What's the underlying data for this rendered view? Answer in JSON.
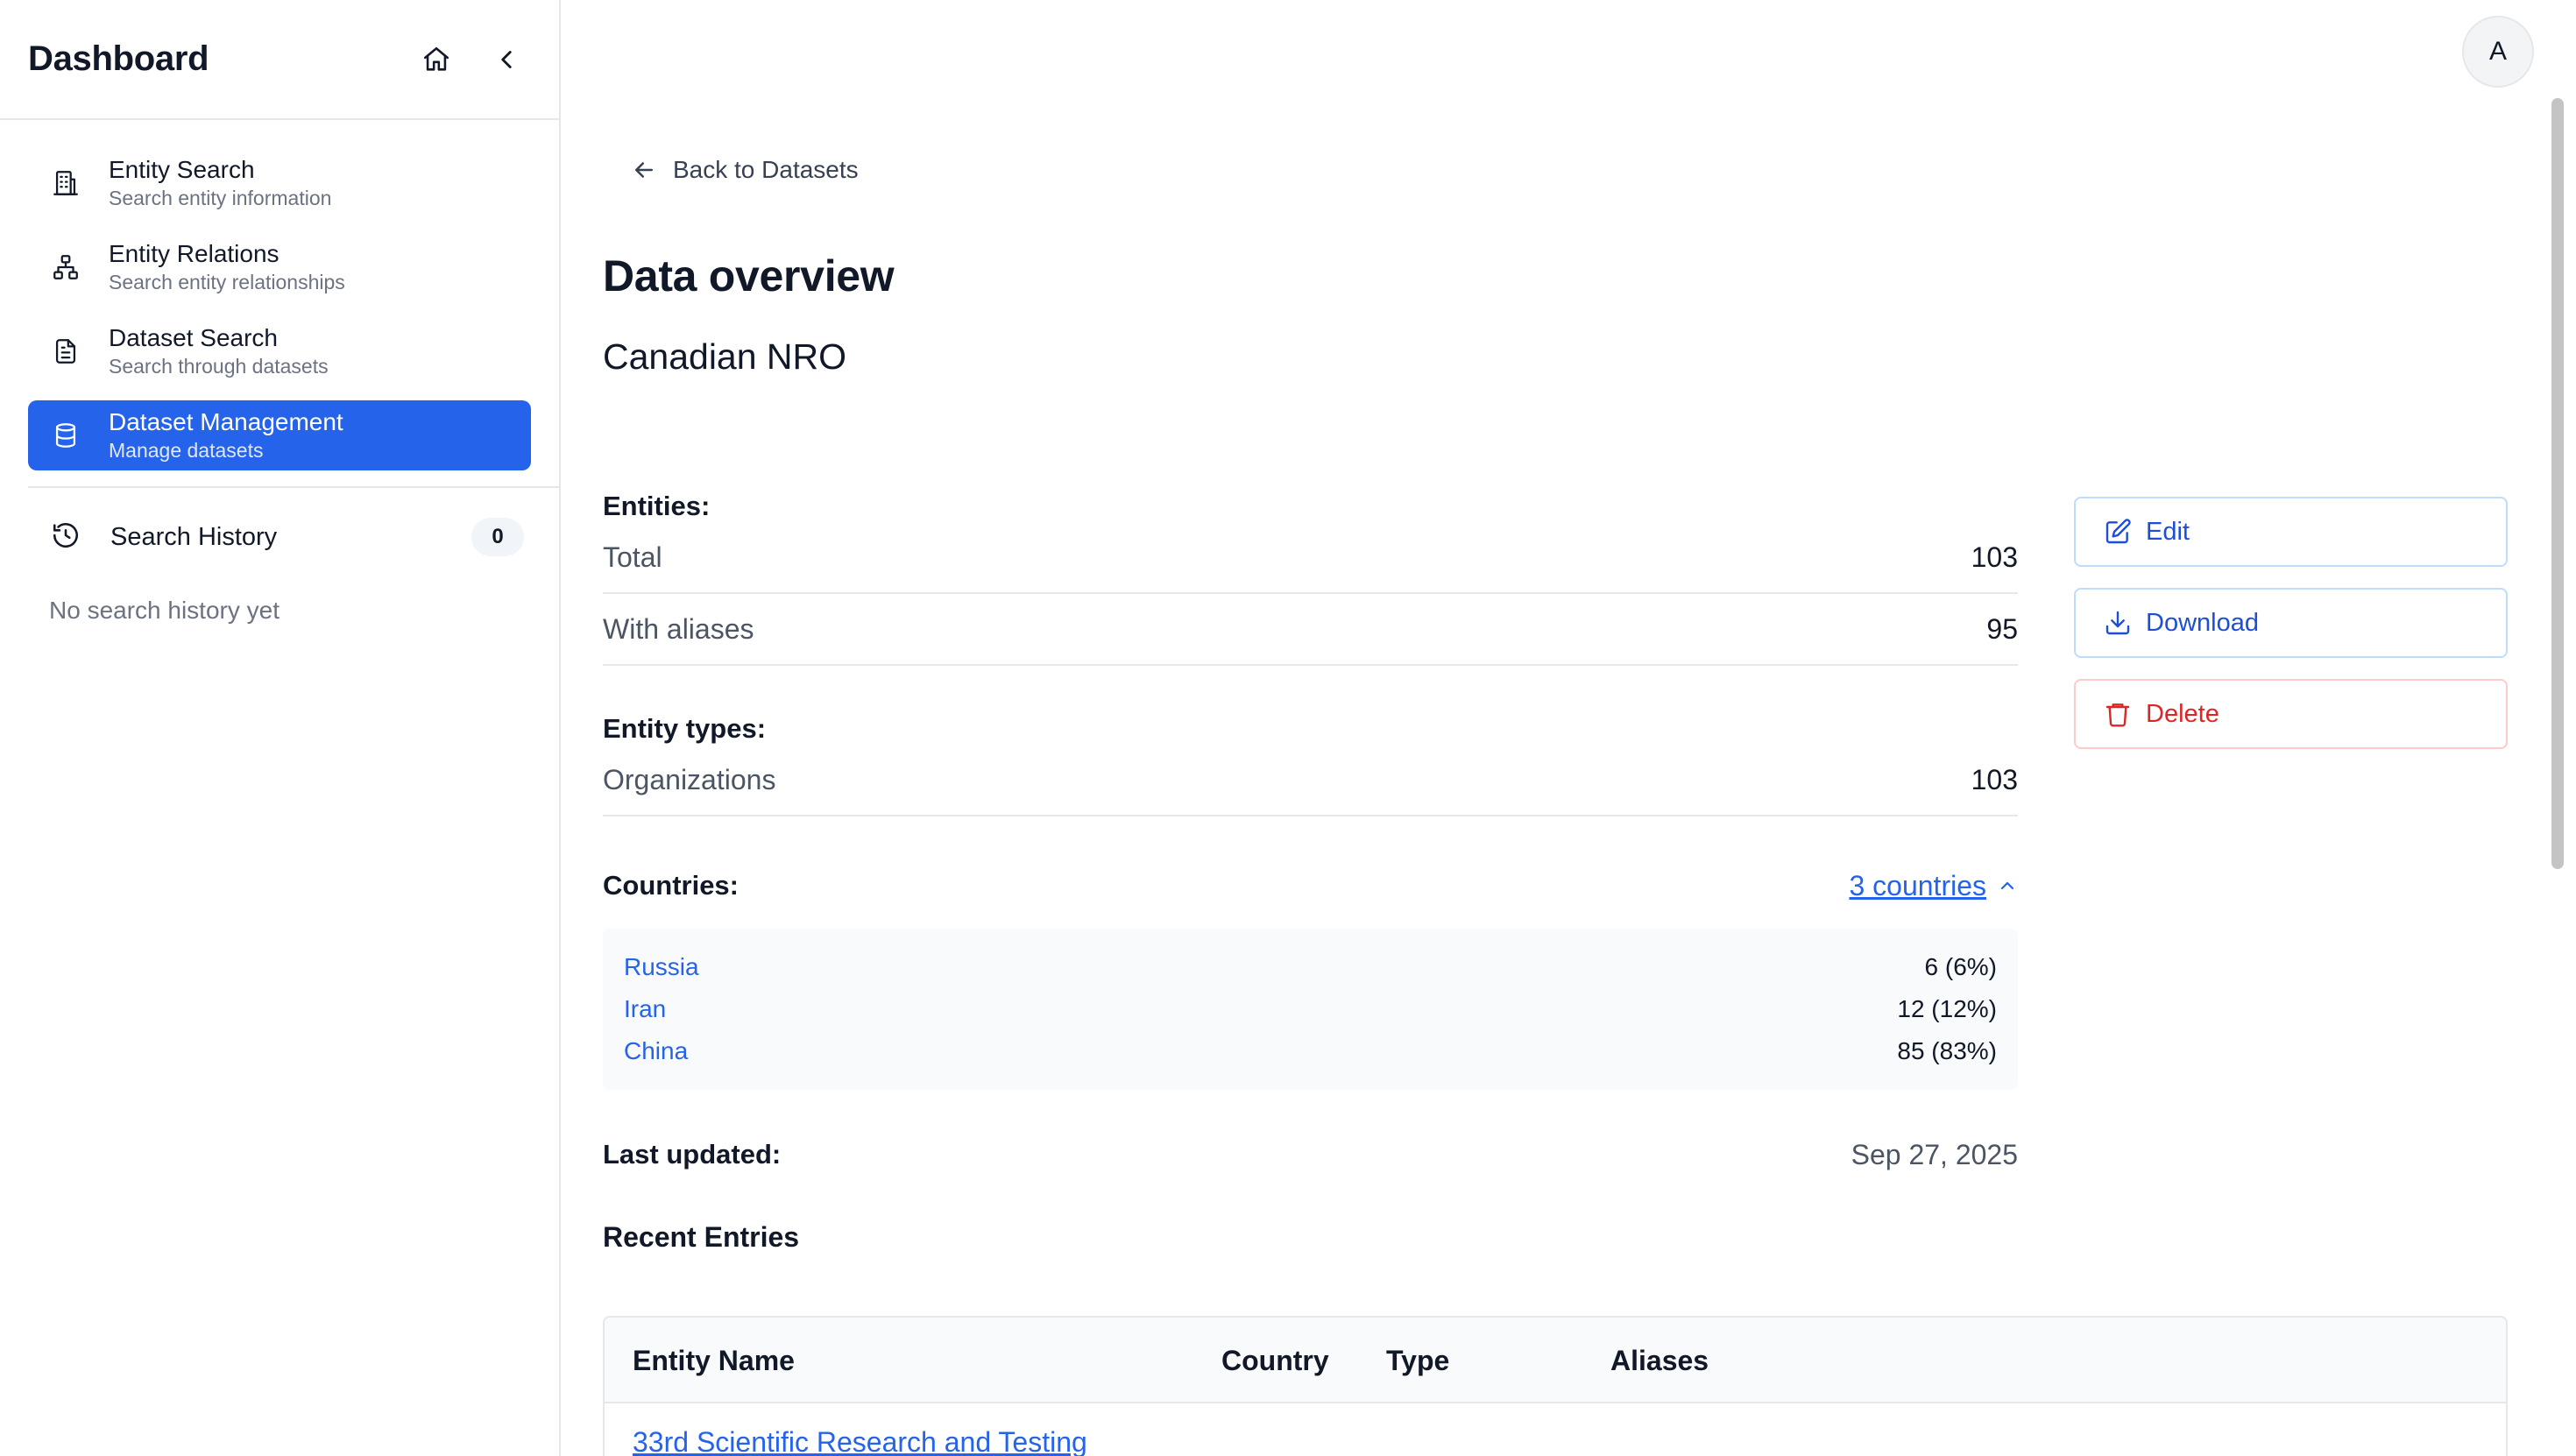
{
  "sidebar": {
    "title": "Dashboard",
    "nav": [
      {
        "label": "Entity Search",
        "sub": "Search entity information",
        "icon": "building-icon"
      },
      {
        "label": "Entity Relations",
        "sub": "Search entity relationships",
        "icon": "network-icon"
      },
      {
        "label": "Dataset Search",
        "sub": "Search through datasets",
        "icon": "document-icon"
      },
      {
        "label": "Dataset Management",
        "sub": "Manage datasets",
        "icon": "database-icon",
        "active": true
      }
    ],
    "history": {
      "label": "Search History",
      "count": "0",
      "empty": "No search history yet"
    }
  },
  "user": {
    "avatar_initial": "A"
  },
  "main": {
    "back_label": "Back to Datasets",
    "title": "Data overview",
    "dataset_name": "Canadian NRO",
    "entities": {
      "title": "Entities:",
      "rows": [
        {
          "label": "Total",
          "value": "103"
        },
        {
          "label": "With aliases",
          "value": "95"
        }
      ]
    },
    "entity_types": {
      "title": "Entity types:",
      "rows": [
        {
          "label": "Organizations",
          "value": "103"
        }
      ]
    },
    "countries": {
      "title": "Countries:",
      "toggle": "3 countries",
      "rows": [
        {
          "name": "Russia",
          "value": "6 (6%)"
        },
        {
          "name": "Iran",
          "value": "12 (12%)"
        },
        {
          "name": "China",
          "value": "85 (83%)"
        }
      ]
    },
    "last_updated": {
      "label": "Last updated:",
      "value": "Sep 27, 2025"
    },
    "recent": {
      "title": "Recent Entries",
      "columns": [
        "Entity Name",
        "Country",
        "Type",
        "Aliases"
      ],
      "rows": [
        {
          "name": "33rd Scientific Research and Testing"
        }
      ]
    }
  },
  "actions": {
    "edit": "Edit",
    "download": "Download",
    "delete": "Delete"
  },
  "colors": {
    "accent": "#2563eb",
    "danger": "#dc2626"
  }
}
